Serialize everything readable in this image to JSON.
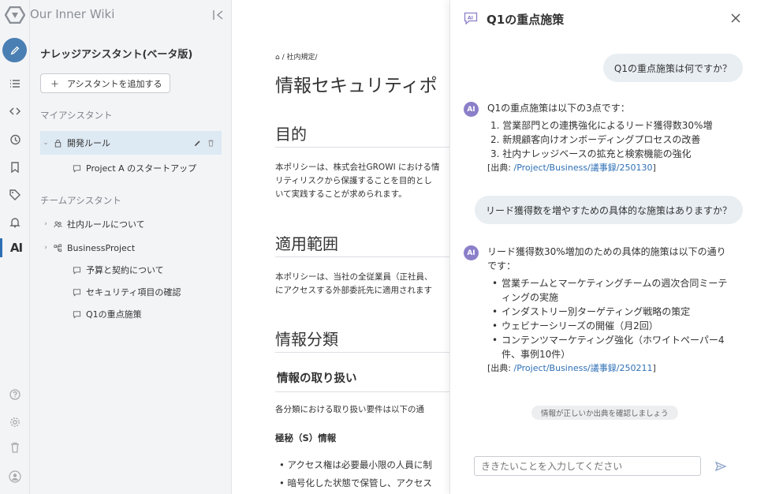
{
  "app": {
    "title": "Our Inner Wiki"
  },
  "rail": {
    "icons": [
      "edit-icon",
      "list-icon",
      "code-icon",
      "history-icon",
      "bookmark-icon",
      "tag-icon",
      "bell-icon",
      "ai-icon",
      "help-icon",
      "gear-icon",
      "trash-icon",
      "user-icon"
    ],
    "ai_label": "AI"
  },
  "sidebar": {
    "panel_title": "ナレッジアシスタント(ベータ版)",
    "add_button": "アシスタントを追加する",
    "my_section": "マイアシスタント",
    "my_items": [
      {
        "label": "開発ルール"
      },
      {
        "label": "Project A のスタートアップ"
      }
    ],
    "team_section": "チームアシスタント",
    "team_items": [
      {
        "label": "社内ルールについて"
      },
      {
        "label": "BusinessProject"
      },
      {
        "label": "予算と契約について"
      },
      {
        "label": "セキュリティ項目の確認"
      },
      {
        "label": "Q1の重点施策"
      }
    ]
  },
  "document": {
    "breadcrumb": "/ 社内規定/",
    "title": "情報セキュリティポ",
    "sections": [
      {
        "heading": "目的",
        "lines": [
          "本ポリシーは、株式会社GROWI における情",
          "リティリスクから保護することを目的とし",
          "いて実践することが求められます。"
        ]
      },
      {
        "heading": "適用範囲",
        "lines": [
          "本ポリシーは、当社の全従業員（正社員、",
          "にアクセスする外部委託先に適用されます"
        ]
      },
      {
        "heading": "情報分類"
      }
    ],
    "h3": "情報の取り扱い",
    "para3": "各分類における取り扱い要件は以下の通",
    "h4": "極秘（S）情報",
    "bullets": [
      "アクセス権は必要最小限の人員に制",
      "暗号化した状態で保管し、アクセス"
    ]
  },
  "ai_panel": {
    "title": "Q1の重点施策",
    "q1": "Q1の重点施策は何ですか？",
    "a1_intro": "Q1の重点施策は以下の3点です：",
    "a1_items": [
      "1. 営業部門との連携強化によるリード獲得数30%増",
      "2. 新規顧客向けオンボーディングプロセスの改善",
      "3. 社内ナレッジベースの拡充と検索機能の強化"
    ],
    "a1_src_prefix": "[出典: ",
    "a1_src_link": "/Project/Business/議事録/250130",
    "a1_src_suffix": "]",
    "q2": "リード獲得数を増やすための具体的な施策はありますか？",
    "a2_intro_1": "リード獲得数30%増加のための具体的施策は以下の通り",
    "a2_intro_2": "です：",
    "a2_items": [
      "営業チームとマーケティングチームの週次合同ミーティングの実施",
      "インダストリー別ターゲティング戦略の策定",
      "ウェビナーシリーズの開催（月2回）",
      "コンテンツマーケティング強化（ホワイトペーパー4件、事例10件）"
    ],
    "a2_src_prefix": "[出典: ",
    "a2_src_link": "/Project/Business/議事録/250211",
    "a2_src_suffix": "]",
    "avatar_label": "AI",
    "notice": "情報が正しいか出典を確認しましょう",
    "input_placeholder": "ききたいことを入力してください"
  }
}
